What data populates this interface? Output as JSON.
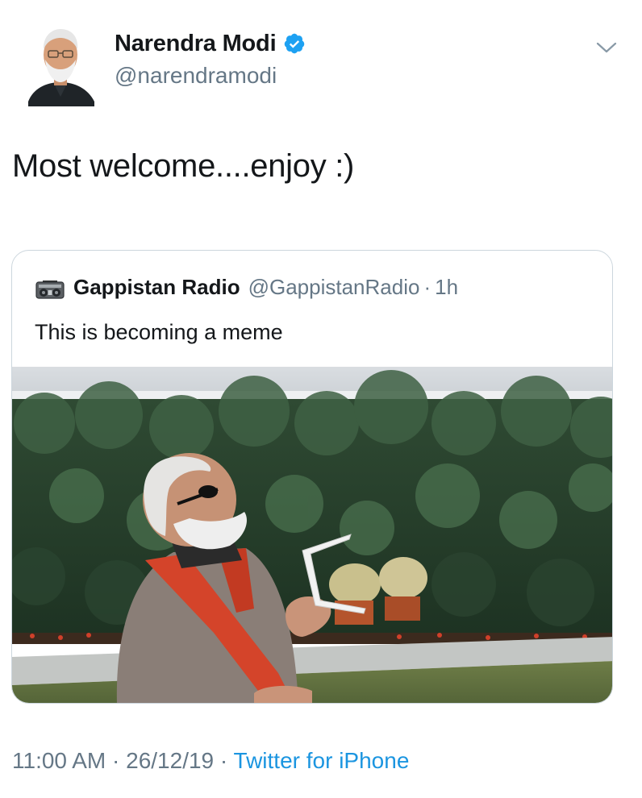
{
  "author": {
    "display_name": "Narendra Modi",
    "handle": "@narendramodi",
    "verified": true
  },
  "tweet": {
    "text": "Most welcome....enjoy :)",
    "time": "11:00 AM",
    "date": "26/12/19",
    "separator": "·",
    "source": "Twitter for iPhone"
  },
  "quoted_tweet": {
    "display_name": "Gappistan Radio",
    "handle": "@GappistanRadio",
    "separator": "·",
    "time": "1h",
    "text": "This is becoming a meme",
    "icon": "radio-icon",
    "has_photo": true
  },
  "icons": {
    "verified": "verified-badge-icon",
    "menu": "chevron-down-icon",
    "avatar": "avatar"
  },
  "colors": {
    "primary_text": "#14171a",
    "secondary_text": "#657786",
    "link": "#1b95e0",
    "verified": "#1da1f2",
    "border": "#ccd6dd"
  }
}
